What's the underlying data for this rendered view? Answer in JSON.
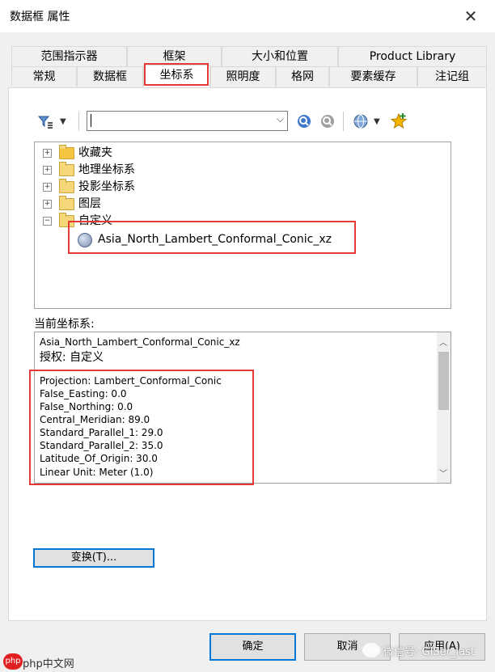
{
  "window": {
    "title": "数据框 属性",
    "close_glyph": "✕"
  },
  "tabs_row1": [
    "范围指示器",
    "框架",
    "大小和位置",
    "Product Library"
  ],
  "tabs_row2": [
    "常规",
    "数据框",
    "坐标系",
    "照明度",
    "格网",
    "要素缓存",
    "注记组"
  ],
  "active_tab": "坐标系",
  "toolbar": {
    "search_value": "",
    "icons": [
      "filter-icon",
      "search-icon",
      "search-clear-icon",
      "globe-icon",
      "favorite-add-icon"
    ]
  },
  "tree": {
    "items": [
      "收藏夹",
      "地理坐标系",
      "投影坐标系",
      "图层",
      "自定义"
    ],
    "child": "Asia_North_Lambert_Conformal_Conic_xz"
  },
  "current_cs": {
    "label": "当前坐标系:",
    "lines": [
      "Asia_North_Lambert_Conformal_Conic_xz",
      "授权: 自定义",
      "Projection: Lambert_Conformal_Conic",
      "False_Easting: 0.0",
      "False_Northing: 0.0",
      "Central_Meridian: 89.0",
      "Standard_Parallel_1: 29.0",
      "Standard_Parallel_2: 35.0",
      "Latitude_Of_Origin: 30.0",
      "Linear Unit: Meter (1.0)"
    ]
  },
  "buttons": {
    "transform": "变换(T)...",
    "ok": "确定",
    "cancel": "取消",
    "apply": "应用(A)"
  },
  "watermark": {
    "left": "php中文网",
    "right": "微信号: GISer_last"
  },
  "colors": {
    "highlight": "#e53935",
    "accent": "#0078d7"
  }
}
